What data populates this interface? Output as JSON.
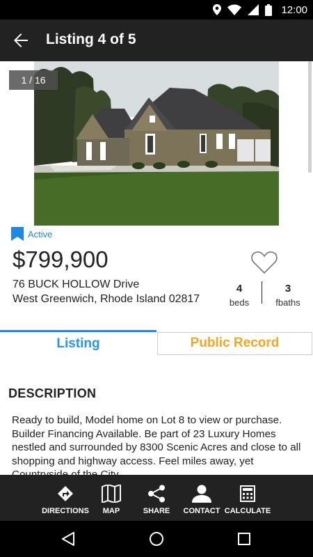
{
  "status_bar": {
    "time": "12:00",
    "icons": [
      "location-icon",
      "wifi-icon",
      "signal-icon",
      "battery-icon"
    ]
  },
  "app_bar": {
    "title": "Listing 4 of 5",
    "back_icon": "arrow-back-icon"
  },
  "photo": {
    "counter": "1 / 16"
  },
  "listing": {
    "status": "Active",
    "price": "$799,900",
    "address_line1": "76 BUCK HOLLOW Drive",
    "address_line2": "West Greenwich, Rhode Island 02817",
    "beds": {
      "value": "4",
      "label": "beds"
    },
    "baths": {
      "value": "3",
      "label": "fbaths"
    }
  },
  "tabs": {
    "listing": "Listing",
    "public_record": "Public Record"
  },
  "description": {
    "heading": "DESCRIPTION",
    "text": "Ready to build, Model home on Lot 8 to view or purchase. Builder Financing Available. Be part of 23 Luxury Homes nestled and surrounded by 8300 Scenic Acres and close to all shopping and highway access. Feel miles away, yet Countryside of the City."
  },
  "actions": {
    "directions": "DIRECTIONS",
    "map": "MAP",
    "share": "SHARE",
    "contact": "CONTACT",
    "calculate": "CALCULATE"
  },
  "colors": {
    "accent": "#1e88e5",
    "public_record": "#f5a623",
    "bar": "#222222"
  }
}
